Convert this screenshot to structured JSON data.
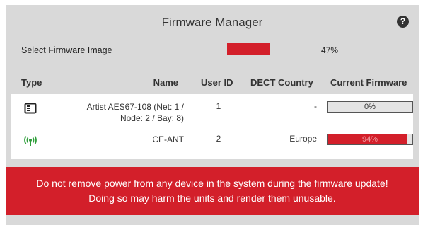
{
  "dialog": {
    "title": "Firmware Manager",
    "help_icon": "question-circle-icon"
  },
  "overall": {
    "label": "Select Firmware Image",
    "progress_text": "47%",
    "progress_fraction": 0.47,
    "fill_color": "#d31f2a"
  },
  "table": {
    "headers": {
      "type": "Type",
      "name": "Name",
      "user_id": "User ID",
      "dect_country": "DECT Country",
      "current_firmware": "Current Firmware"
    },
    "rows": [
      {
        "icon": "device-module-icon",
        "name_line1": "Artist AES67-108 (Net: 1 /",
        "name_line2": "Node: 2 / Bay: 8)",
        "user_id": "1",
        "dect_country": "-",
        "firmware_text": "0%",
        "firmware_fraction": 0.0
      },
      {
        "icon": "antenna-signal-icon",
        "name_line1": "CE-ANT",
        "name_line2": "",
        "user_id": "2",
        "dect_country": "Europe",
        "firmware_text": "94%",
        "firmware_fraction": 0.94
      }
    ]
  },
  "warning": {
    "line1": "Do not remove power from any device in the system during the firmware update!",
    "line2": "Doing so may harm the units and render them unusable.",
    "background": "#d31f2a"
  },
  "colors": {
    "accent_red": "#d31f2a",
    "antenna_green": "#2e9e3a",
    "dialog_bg": "#d9d9d9"
  }
}
